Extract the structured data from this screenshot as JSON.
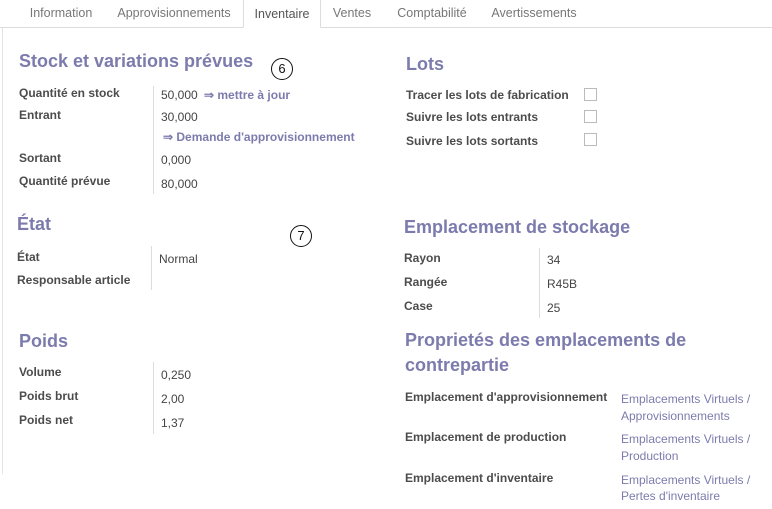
{
  "tabs": [
    {
      "label": "Information"
    },
    {
      "label": "Approvisionnements"
    },
    {
      "label": "Inventaire"
    },
    {
      "label": "Ventes"
    },
    {
      "label": "Comptabilité"
    },
    {
      "label": "Avertissements"
    }
  ],
  "active_tab": "Inventaire",
  "callouts": [
    "6",
    "7"
  ],
  "stock": {
    "title": "Stock et variations prévues",
    "qty_label": "Quantité en stock",
    "qty_value": "50,000",
    "update_link": "⇒ mettre à jour",
    "incoming_label": "Entrant",
    "incoming_value": "30,000",
    "procurement_link": "⇒ Demande d'approvisionnement",
    "outgoing_label": "Sortant",
    "outgoing_value": "0,000",
    "forecast_label": "Quantité prévue",
    "forecast_value": "80,000"
  },
  "lots": {
    "title": "Lots",
    "items": [
      {
        "label": "Tracer les lots de fabrication",
        "checked": false
      },
      {
        "label": "Suivre les lots entrants",
        "checked": false
      },
      {
        "label": "Suivre les lots sortants",
        "checked": false
      }
    ]
  },
  "etat": {
    "title": "État",
    "state_label": "État",
    "state_value": "Normal",
    "manager_label": "Responsable article",
    "manager_value": ""
  },
  "storage": {
    "title": "Emplacement de stockage",
    "rack_label": "Rayon",
    "rack_value": "34",
    "row_label": "Rangée",
    "row_value": "R45B",
    "case_label": "Case",
    "case_value": "25"
  },
  "weight": {
    "title": "Poids",
    "volume_label": "Volume",
    "volume_value": "0,250",
    "gross_label": "Poids brut",
    "gross_value": "2,00",
    "net_label": "Poids net",
    "net_value": "1,37"
  },
  "counterpart": {
    "title_line1": "Proprietés des emplacements de",
    "title_line2": "contrepartie",
    "procurement_label": "Emplacement d'approvisionnement",
    "procurement_line1": "Emplacements Virtuels /",
    "procurement_line2": "Approvisionnements",
    "production_label": "Emplacement de production",
    "production_line1": "Emplacements Virtuels /",
    "production_line2": "Production",
    "inventory_label": "Emplacement d'inventaire",
    "inventory_line1": "Emplacements Virtuels /",
    "inventory_line2": "Pertes d'inventaire"
  }
}
